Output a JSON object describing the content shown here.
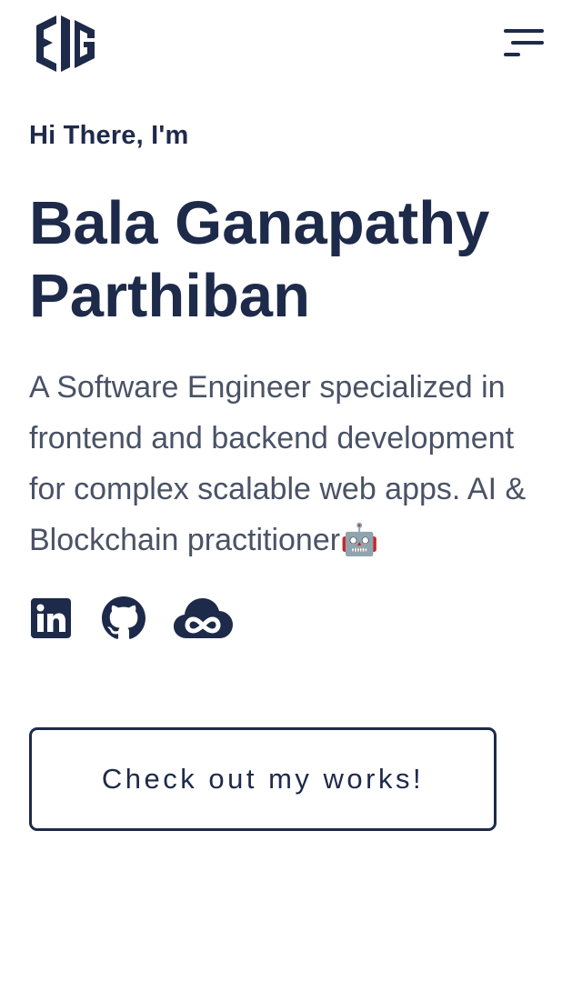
{
  "header": {
    "logo_icon": "bg-monogram-logo-icon",
    "menu_icon": "hamburger-menu-icon"
  },
  "hero": {
    "greeting": "Hi There, I'm",
    "name_line1": "Bala Ganapathy",
    "name_line2": "Parthiban",
    "bio": "A Software Engineer specialized in frontend and backend development for complex scalable web apps. AI & Blockchain practitioner🤖"
  },
  "socials": [
    {
      "icon": "linkedin-icon"
    },
    {
      "icon": "github-icon"
    },
    {
      "icon": "cloud-infinity-icon"
    }
  ],
  "cta": {
    "label": "Check out my works!"
  },
  "colors": {
    "primary": "#1e2a4a",
    "body_text": "#4a5266",
    "background": "#ffffff"
  }
}
